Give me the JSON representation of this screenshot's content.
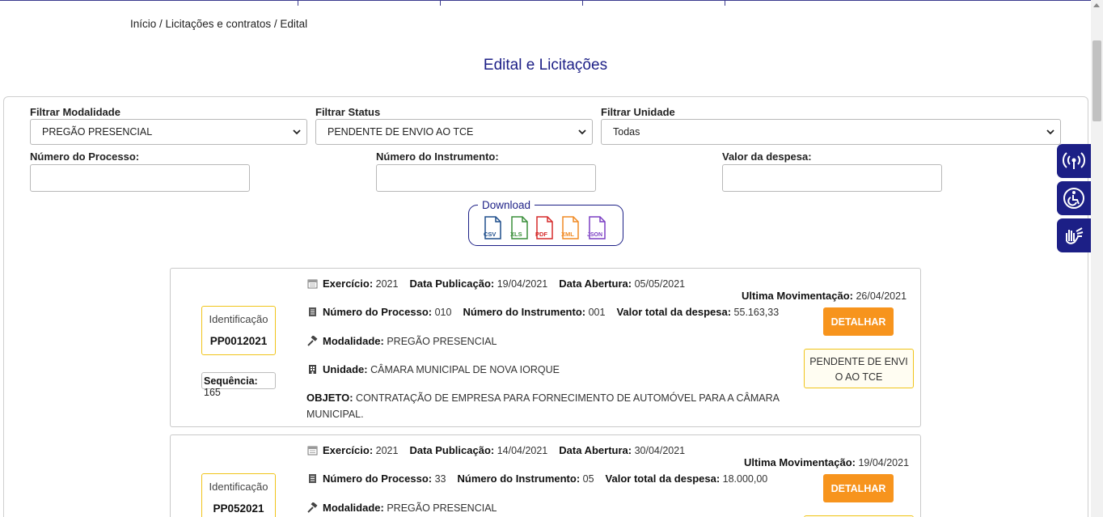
{
  "breadcrumb": "Início / Licitações e contratos / Edital",
  "page_title": "Edital e Licitações",
  "filters": {
    "modalidade_label": "Filtrar Modalidade",
    "modalidade_value": "PREGÃO PRESENCIAL",
    "status_label": "Filtrar Status",
    "status_value": "PENDENTE DE ENVIO AO TCE",
    "unidade_label": "Filtrar Unidade",
    "unidade_value": "Todas",
    "processo_label": "Número do Processo:",
    "instrumento_label": "Número do Instrumento:",
    "valor_label": "Valor da despesa:"
  },
  "download": {
    "legend": "Download",
    "formats": [
      {
        "label": "CSV",
        "color": "#1f4e8c"
      },
      {
        "label": "XLS",
        "color": "#3a8f3a"
      },
      {
        "label": "PDF",
        "color": "#d62b2b"
      },
      {
        "label": "XML",
        "color": "#f08a24"
      },
      {
        "label": "JSON",
        "color": "#7b3fc4"
      }
    ]
  },
  "labels": {
    "identificacao": "Identificação",
    "sequencia": "Sequência:",
    "exercicio": "Exercício:",
    "data_publicacao": "Data Publicação:",
    "data_abertura": "Data Abertura:",
    "ultima_movimentacao": "Ultima Movimentação:",
    "numero_processo": "Número do Processo:",
    "numero_instrumento": "Número do Instrumento:",
    "valor_total": "Valor total da despesa:",
    "modalidade": "Modalidade:",
    "unidade": "Unidade:",
    "objeto": "OBJETO:",
    "detalhar": "DETALHAR"
  },
  "records": [
    {
      "codigo": "PP0012021",
      "sequencia": "165",
      "exercicio": "2021",
      "data_publicacao": "19/04/2021",
      "data_abertura": "05/05/2021",
      "ultima_movimentacao": "26/04/2021",
      "numero_processo": "010",
      "numero_instrumento": "001",
      "valor_total": "55.163,33",
      "modalidade": "PREGÃO PRESENCIAL",
      "unidade": "CÂMARA MUNICIPAL DE NOVA IORQUE",
      "objeto": "CONTRATAÇÃO DE EMPRESA PARA FORNECIMENTO DE AUTOMÓVEL PARA A CÂMARA MUNICIPAL.",
      "status_line1": "PENDENTE DE ENVI",
      "status_line2": "O AO TCE"
    },
    {
      "codigo": "PP052021",
      "exercicio": "2021",
      "data_publicacao": "14/04/2021",
      "data_abertura": "30/04/2021",
      "ultima_movimentacao": "19/04/2021",
      "numero_processo": "33",
      "numero_instrumento": "05",
      "valor_total": "18.000,00",
      "modalidade": "PREGÃO PRESENCIAL"
    }
  ],
  "colors": {
    "brand": "#1c1f86",
    "detalhar": "#f7941d",
    "badge_border": "#f0c419"
  }
}
